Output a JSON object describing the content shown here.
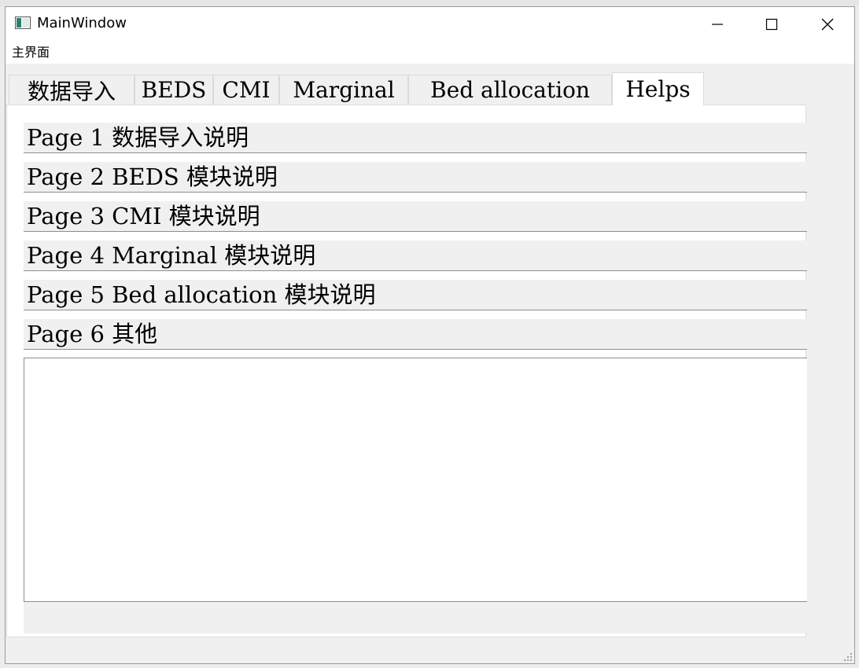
{
  "window": {
    "title": "MainWindow",
    "menu": [
      "主界面"
    ]
  },
  "tabs": [
    {
      "label": "数据导入",
      "active": false
    },
    {
      "label": "BEDS",
      "active": false
    },
    {
      "label": "CMI",
      "active": false
    },
    {
      "label": "Marginal",
      "active": false
    },
    {
      "label": "Bed allocation",
      "active": false
    },
    {
      "label": "Helps",
      "active": true
    }
  ],
  "help_sections": [
    {
      "label": "Page 1 数据导入说明"
    },
    {
      "label": "Page 2 BEDS 模块说明"
    },
    {
      "label": "Page 3 CMI 模块说明"
    },
    {
      "label": "Page 4 Marginal 模块说明"
    },
    {
      "label": "Page 5 Bed allocation 模块说明"
    },
    {
      "label": "Page 6 其他"
    }
  ],
  "icons": {
    "app": "window-app-icon",
    "minimize": "minimize-icon",
    "maximize": "maximize-icon",
    "close": "close-icon",
    "grip": "resize-grip-icon"
  }
}
